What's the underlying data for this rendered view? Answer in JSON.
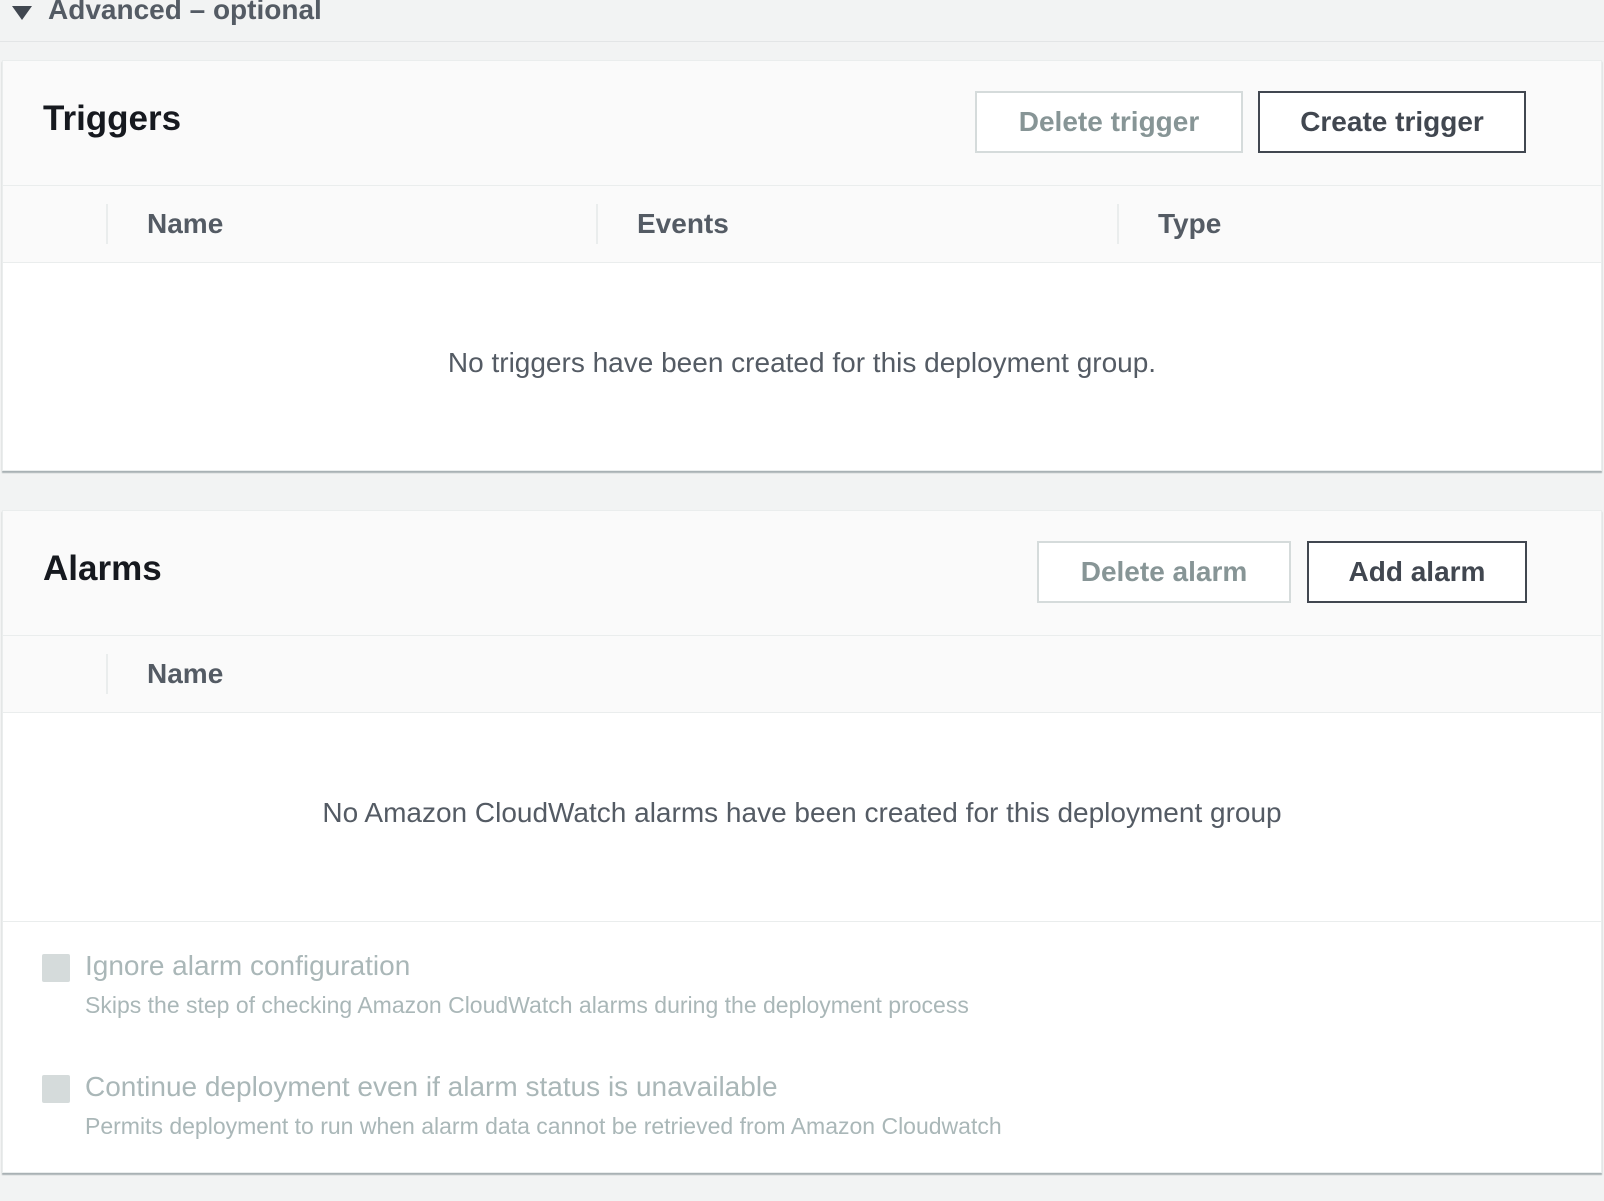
{
  "advanced": {
    "title": "Advanced – optional"
  },
  "triggers": {
    "title": "Triggers",
    "delete_label": "Delete trigger",
    "create_label": "Create trigger",
    "columns": [
      "Name",
      "Events",
      "Type"
    ],
    "empty_message": "No triggers have been created for this deployment group."
  },
  "alarms": {
    "title": "Alarms",
    "delete_label": "Delete alarm",
    "add_label": "Add alarm",
    "columns": [
      "Name"
    ],
    "empty_message": "No Amazon CloudWatch alarms have been created for this deployment group",
    "options": [
      {
        "label": "Ignore alarm configuration",
        "description": "Skips the step of checking Amazon CloudWatch alarms during the deployment process",
        "checked": false
      },
      {
        "label": "Continue deployment even if alarm status is unavailable",
        "description": "Permits deployment to run when alarm data cannot be retrieved from Amazon Cloudwatch",
        "checked": false
      }
    ]
  }
}
